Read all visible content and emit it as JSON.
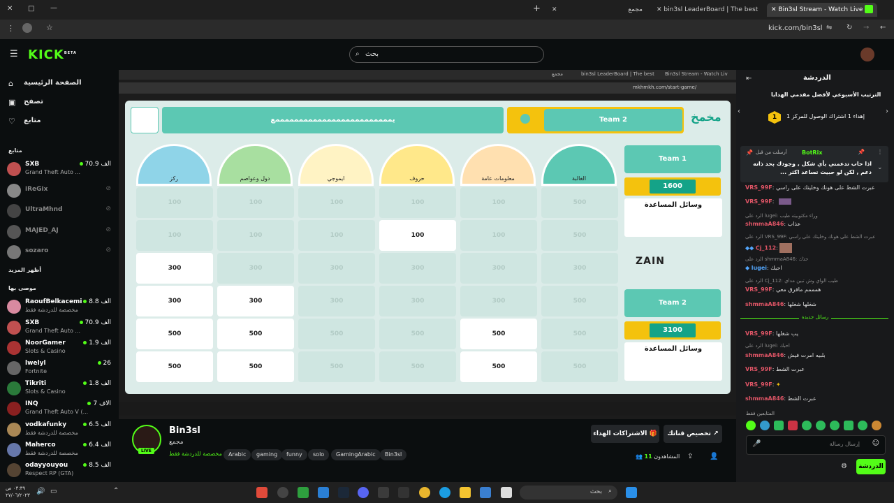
{
  "browser": {
    "tabs": [
      {
        "label": "مجمع"
      },
      {
        "label": "bin3sl LeaderBoard | The best"
      },
      {
        "label": "Bin3sl Stream - Watch Live on"
      }
    ],
    "url": "kick.com/bin3sl"
  },
  "site": {
    "logo": "KICK",
    "logo_badge": "BETA",
    "search_placeholder": "بحث"
  },
  "sidebar": {
    "nav": [
      {
        "label": "الصفحة الرئيسية",
        "icon": "home-icon"
      },
      {
        "label": "تصفح",
        "icon": "browse-icon"
      },
      {
        "label": "متابع",
        "icon": "heart-icon"
      }
    ],
    "following_title": "متابع",
    "following": [
      {
        "name": "SXB",
        "game": "Grand Theft Auto ...",
        "viewers": "70.9 الف",
        "live": true,
        "color": "#c05050"
      },
      {
        "name": "iReGix",
        "game": "",
        "viewers": "",
        "live": false,
        "color": "#888"
      },
      {
        "name": "UltraMhnd",
        "game": "",
        "viewers": "",
        "live": false,
        "color": "#444"
      },
      {
        "name": "MAJED_AJ",
        "game": "",
        "viewers": "",
        "live": false,
        "color": "#555"
      },
      {
        "name": "sozaro",
        "game": "",
        "viewers": "",
        "live": false,
        "color": "#777"
      }
    ],
    "show_more": "أظهر المزيد",
    "recommended_title": "موصى بها",
    "recommended": [
      {
        "name": "RaoufBelkacemi",
        "game": "مخصصة للدردشة فقط",
        "viewers": "8.8 الف",
        "color": "#d98aa0"
      },
      {
        "name": "SXB",
        "game": "Grand Theft Auto ...",
        "viewers": "70.9 الف",
        "color": "#c05050"
      },
      {
        "name": "NoorGamer",
        "game": "Slots & Casino",
        "viewers": "1.9 الف",
        "color": "#aa3333"
      },
      {
        "name": "lwelyl",
        "game": "Fortnite",
        "viewers": "26",
        "color": "#666"
      },
      {
        "name": "Tikriti",
        "game": "Slots & Casino",
        "viewers": "1.8 الف",
        "color": "#2a7a3a"
      },
      {
        "name": "INQ",
        "game": "Grand Theft Auto V (...",
        "viewers": "7 الاف",
        "color": "#8a2020"
      },
      {
        "name": "vodkafunky",
        "game": "مخصصة للدردشة فقط",
        "viewers": "6.5 الف",
        "color": "#aa8855"
      },
      {
        "name": "Maherco",
        "game": "مخصصة للدردشة فقط",
        "viewers": "6.4 الف",
        "color": "#6677aa"
      },
      {
        "name": "odayyouyou",
        "game": "Respect RP (GTA)",
        "viewers": "8.5 الف",
        "color": "#554433"
      }
    ]
  },
  "inner_browser": {
    "tabs": [
      {
        "label": "مجمع"
      },
      {
        "label": "bin3sl LeaderBoard | The best"
      },
      {
        "label": "Bin3sl Stream - Watch Live on"
      }
    ],
    "url": "mkhmkh.com/start-game/"
  },
  "game": {
    "title_banner": "يمممممممممممممممممممممممممع",
    "top_team": "Team 2",
    "categories": [
      {
        "label": "الغالبة"
      },
      {
        "label": "معلومات عامة"
      },
      {
        "label": "حروف"
      },
      {
        "label": "ايموجي"
      },
      {
        "label": "دول وعواصم"
      },
      {
        "label": "ركز"
      }
    ],
    "columns": [
      [
        "500",
        "500",
        "300",
        "500",
        "500",
        "500"
      ],
      [
        "100",
        "100",
        "300",
        "300",
        "500",
        "500"
      ],
      [
        "100",
        "100",
        "300",
        "300",
        "500",
        "500"
      ],
      [
        "100",
        "100",
        "300",
        "300",
        "500",
        "500"
      ],
      [
        "100",
        "100",
        "300",
        "300",
        "500",
        "500"
      ],
      [
        "100",
        "100",
        "300",
        "300",
        "500",
        "500"
      ]
    ],
    "teams": [
      {
        "name": "Team 1",
        "score": "1600",
        "help_label": "وسائل المساعدة"
      },
      {
        "name": "Team 2",
        "score": "3100",
        "help_label": "وسائل المساعدة"
      }
    ],
    "sponsor": "ZAIN"
  },
  "channel": {
    "name": "Bin3sl",
    "subtitle": "مجمع",
    "category": "مخصصة للدردشة فقط",
    "live_badge": "LIVE",
    "tags": [
      "Arabic",
      "gaming",
      "funny",
      "solo",
      "GamingArabic",
      "Bin3sl"
    ],
    "viewers_label": "المشاهدون",
    "viewers": "11",
    "subscriptions_btn": "الاشتراكات الهداء",
    "customize_btn": "تخصيص قناتك"
  },
  "chat": {
    "title": "الدردشة",
    "leaderboard_title": "الترتيب الأسبوعي لأفضل مقدمي الهدايا",
    "leaderboard_text": "إهداء 1 اشتراك الوصول للمركز 1",
    "pinned_author": "BotRix",
    "pinned_sent": "أرسلت من قبل",
    "pinned_text": "اذا حاب تدعمني بأي شكل , وجودك بحد ذاته دعم , لكن لو حبيت تساعد اكثر ...",
    "messages": [
      {
        "user": "VRS_99F",
        "text": "عبرت الشط على هونك وخليتك على راسي",
        "color": "#e05566"
      },
      {
        "user": "VRS_99F",
        "text": "",
        "color": "#e05566"
      },
      {
        "reply": "الرد على lugei: وراء مكتوبيته طيب"
      },
      {
        "user": "shmmaA846",
        "text": "عذاب",
        "color": "#e05566"
      },
      {
        "reply": "الرد على VRS_99F: عبرت الشط على هونك وخليتك على راسي"
      },
      {
        "user": "Cj_112",
        "text": "",
        "color": "#e05566"
      },
      {
        "reply": "الرد على shmmaA846: حذك"
      },
      {
        "user": "lugei",
        "text": "احبك",
        "color": "#53a6fc"
      },
      {
        "reply": "الرد على Cj_112: طيب الواي وش تبين مداي"
      },
      {
        "user": "VRS_99F",
        "text": "همممم مافرق معي",
        "color": "#e05566"
      },
      {
        "user": "shmmaA846",
        "text": "شغلها شغلها",
        "color": "#e05566"
      },
      {
        "user": "VRS_99F",
        "text": "يب شغلها",
        "color": "#e05566"
      },
      {
        "reply": "الرد على lugei: احبك"
      },
      {
        "user": "shmmaA846",
        "text": "بلبيه امرت فيش",
        "color": "#e05566"
      },
      {
        "user": "VRS_99F",
        "text": "عبرت الشط",
        "color": "#e05566"
      },
      {
        "user": "VRS_99F",
        "text": "",
        "color": "#e05566"
      },
      {
        "user": "shmmaA846",
        "text": "عبرت الشط",
        "color": "#e05566"
      }
    ],
    "new_messages": "رسائل جديدة",
    "emote_label": "المتابعين فقط",
    "input_placeholder": "إرسال رسالة",
    "send_button": "الدردشة"
  },
  "taskbar": {
    "search": "بحث",
    "time": "٠٣:٣٩ ص",
    "date": "٢٧/٠٦/٢٠٢٣"
  }
}
